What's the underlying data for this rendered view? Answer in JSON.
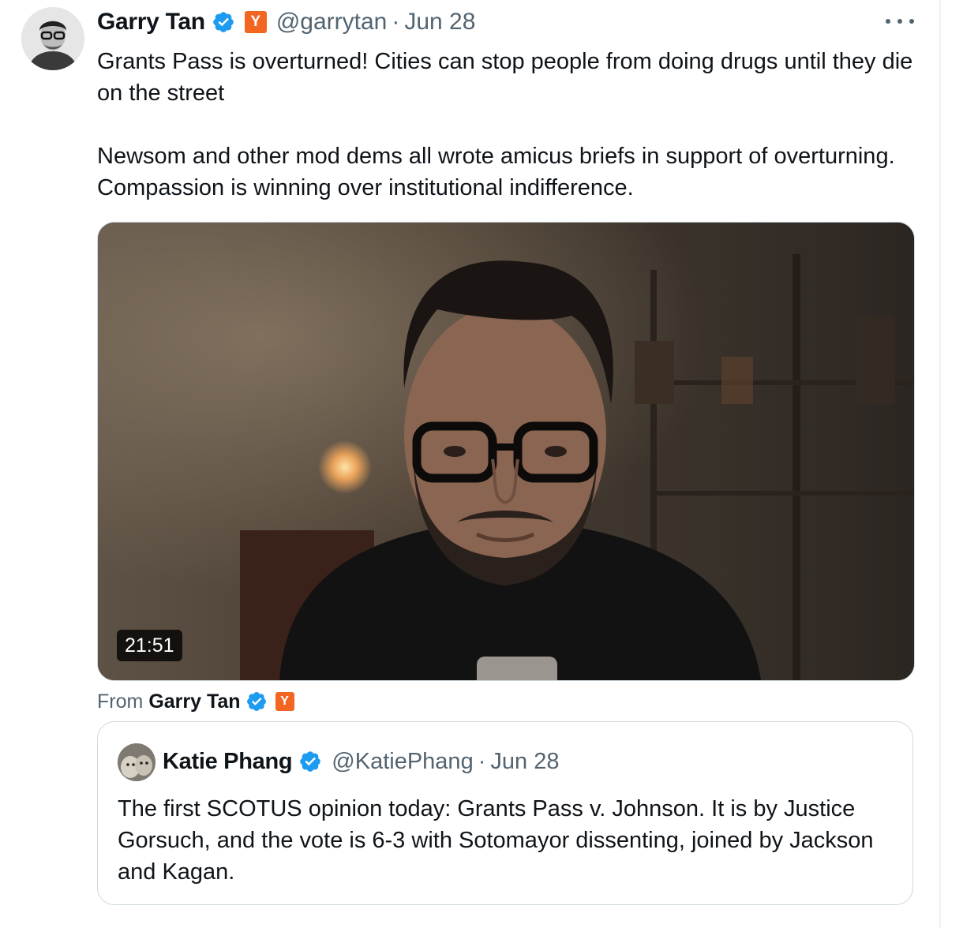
{
  "tweet": {
    "author": {
      "name": "Garry Tan",
      "handle": "@garrytan",
      "affiliate_badge": "Y"
    },
    "time": "Jun 28",
    "separator": "·",
    "paragraphs": [
      "Grants Pass is overturned! Cities can stop people from doing drugs until they die on the street",
      "Newsom and other mod dems all wrote amicus briefs in support of overturning. Compassion is winning over institutional indifference."
    ],
    "media": {
      "duration": "21:51"
    },
    "attribution": {
      "label": "From",
      "name": "Garry Tan",
      "affiliate_badge": "Y"
    }
  },
  "quoted_tweet": {
    "author": {
      "name": "Katie Phang",
      "handle": "@KatiePhang"
    },
    "time": "Jun 28",
    "separator": "·",
    "text": "The first SCOTUS opinion today: Grants Pass v. Johnson. It is by Justice Gorsuch, and the vote is 6-3 with Sotomayor dissenting, joined by Jackson and Kagan."
  },
  "icons": {
    "verified": "verified-badge-icon",
    "more": "more-horizontal-icon",
    "affiliate": "y-combinator-badge-icon"
  },
  "colors": {
    "verified_blue": "#1d9bf0",
    "secondary_text": "#536471",
    "yc_orange": "#f26622",
    "border": "#cfd9de"
  }
}
